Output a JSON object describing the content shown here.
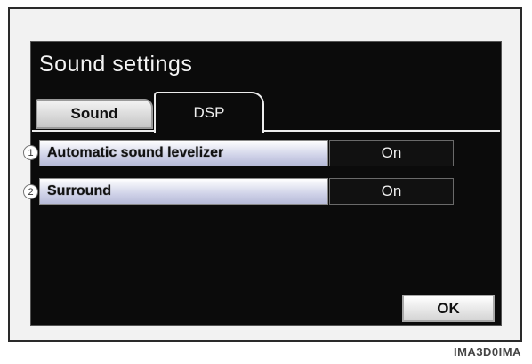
{
  "window": {
    "title": "Sound settings"
  },
  "tabs": [
    {
      "label": "Sound",
      "active": false
    },
    {
      "label": "DSP",
      "active": true
    }
  ],
  "settings": [
    {
      "marker": "1",
      "label": "Automatic sound levelizer",
      "value": "On"
    },
    {
      "marker": "2",
      "label": "Surround",
      "value": "On"
    }
  ],
  "footer": {
    "ok_label": "OK"
  },
  "watermark": "IMA3D0IMA",
  "colors": {
    "screen_bg": "#0b0b0b",
    "row_highlight": "#cfd2e8",
    "text_light": "#f4f4f4"
  }
}
